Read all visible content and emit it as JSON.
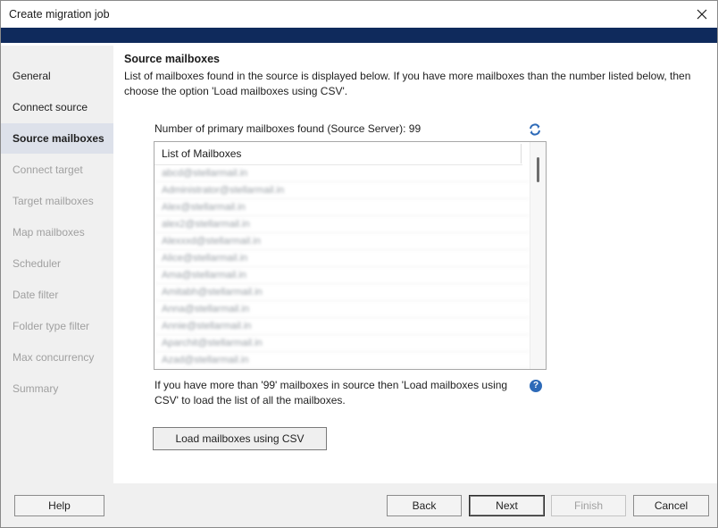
{
  "window": {
    "title": "Create migration job"
  },
  "nav": {
    "items": [
      {
        "label": "General",
        "state": "enabled"
      },
      {
        "label": "Connect source",
        "state": "enabled"
      },
      {
        "label": "Source mailboxes",
        "state": "active"
      },
      {
        "label": "Connect target",
        "state": "disabled"
      },
      {
        "label": "Target mailboxes",
        "state": "disabled"
      },
      {
        "label": "Map mailboxes",
        "state": "disabled"
      },
      {
        "label": "Scheduler",
        "state": "disabled"
      },
      {
        "label": "Date filter",
        "state": "disabled"
      },
      {
        "label": "Folder type filter",
        "state": "disabled"
      },
      {
        "label": "Max concurrency",
        "state": "disabled"
      },
      {
        "label": "Summary",
        "state": "disabled"
      }
    ]
  },
  "content": {
    "title": "Source mailboxes",
    "description": "List of mailboxes found in the source is displayed below. If you have more mailboxes than the number listed below, then choose the option 'Load mailboxes using CSV'.",
    "count_label": "Number of primary mailboxes found (Source Server): 99",
    "list": {
      "header": "List of Mailboxes",
      "rows": [
        "abcd@stellarmail.in",
        "Administrator@stellarmail.in",
        "Alex@stellarmail.in",
        "alex2@stellarmail.in",
        "Alexxxd@stellarmail.in",
        "Alice@stellarmail.in",
        "Ama@stellarmail.in",
        "Amitabh@stellarmail.in",
        "Anna@stellarmail.in",
        "Annie@stellarmail.in",
        "Aparchit@stellarmail.in",
        "Azad@stellarmail.in"
      ]
    },
    "note": "If you have more than '99' mailboxes in source then 'Load mailboxes using CSV' to load the list of all the mailboxes.",
    "csv_button": "Load mailboxes using CSV"
  },
  "footer": {
    "help": "Help",
    "back": "Back",
    "next": "Next",
    "finish": "Finish",
    "cancel": "Cancel"
  },
  "colors": {
    "banner": "#0f2a5c",
    "active_nav": "#dde1ea",
    "icon_blue": "#2d6ab8"
  },
  "icons": {
    "close": "close-icon",
    "refresh": "refresh-icon",
    "help": "help-icon"
  }
}
